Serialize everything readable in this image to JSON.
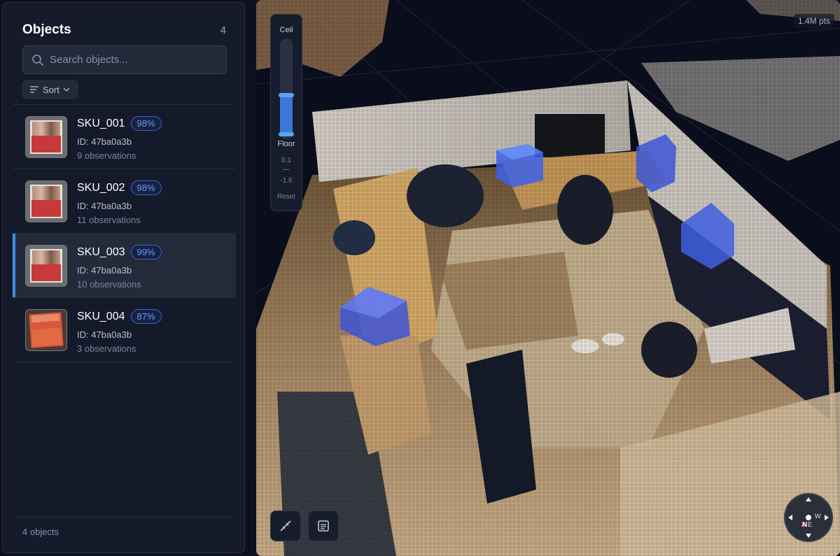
{
  "sidebar": {
    "title": "Objects",
    "count": "4",
    "search_placeholder": "Search objects...",
    "sort_label": "Sort",
    "footer": "4 objects",
    "items": [
      {
        "name": "SKU_001",
        "confidence": "98%",
        "id": "ID: 47ba0a3b",
        "observations": "9 observations",
        "selected": false
      },
      {
        "name": "SKU_002",
        "confidence": "98%",
        "id": "ID: 47ba0a3b",
        "observations": "11 observations",
        "selected": false
      },
      {
        "name": "SKU_003",
        "confidence": "99%",
        "id": "ID: 47ba0a3b",
        "observations": "10 observations",
        "selected": true
      },
      {
        "name": "SKU_004",
        "confidence": "87%",
        "id": "ID: 47ba0a3b",
        "observations": "3 observations",
        "selected": false
      }
    ]
  },
  "viewer": {
    "points_label": "1.4M pts",
    "height_filter": {
      "ceil_label": "Ceil",
      "floor_label": "Floor",
      "ceil_value": "0.1",
      "separator": "—",
      "floor_value": "-1.6",
      "reset_label": "Reset"
    },
    "tools": [
      {
        "icon": "measure-icon"
      },
      {
        "icon": "list-icon"
      }
    ],
    "compass": {
      "north": "N",
      "west": "W",
      "east": "E"
    }
  },
  "colors": {
    "accent": "#3d8fe6",
    "badge": "#6d97ff",
    "box": "#3b5bdc"
  }
}
